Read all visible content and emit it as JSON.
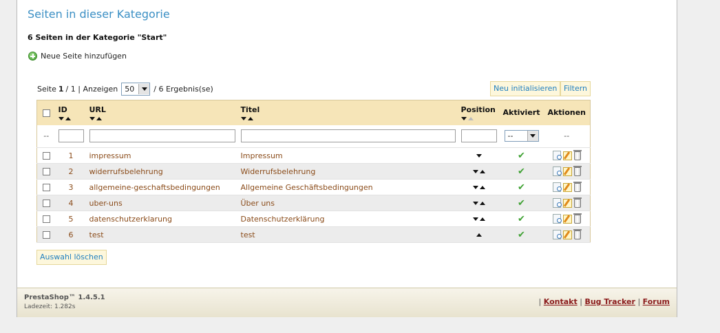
{
  "page_title": "Seiten in dieser Kategorie",
  "subtitle": "6 Seiten in der Kategorie \"Start\"",
  "add_page_label": "Neue Seite hinzufügen",
  "pagination": {
    "prefix": "Seite",
    "current": "1",
    "separator": "/ 1 | Anzeigen",
    "per_page": "50",
    "results": "/ 6 Ergebnis(se)"
  },
  "buttons": {
    "reset": "Neu initialisieren",
    "filter": "Filtern",
    "clear_selection": "Auswahl löschen"
  },
  "columns": {
    "id": "ID",
    "url": "URL",
    "title": "Titel",
    "position": "Position",
    "active": "Aktiviert",
    "actions": "Aktionen"
  },
  "filters": {
    "dash": "--",
    "active_value": "--"
  },
  "rows": [
    {
      "id": "1",
      "url": "impressum",
      "title": "Impressum",
      "pos_down": true,
      "pos_up": false
    },
    {
      "id": "2",
      "url": "widerrufsbelehrung",
      "title": "Widerrufsbelehrung",
      "pos_down": true,
      "pos_up": true
    },
    {
      "id": "3",
      "url": "allgemeine-geschaftsbedingungen",
      "title": "Allgemeine Geschäftsbedingungen",
      "pos_down": true,
      "pos_up": true
    },
    {
      "id": "4",
      "url": "uber-uns",
      "title": "Über uns",
      "pos_down": true,
      "pos_up": true
    },
    {
      "id": "5",
      "url": "datenschutzerklarung",
      "title": "Datenschutzerklärung",
      "pos_down": true,
      "pos_up": true
    },
    {
      "id": "6",
      "url": "test",
      "title": "test",
      "pos_down": false,
      "pos_up": true
    }
  ],
  "footer": {
    "brand": "PrestaShop™ 1.4.5.1",
    "load_time": "Ladezeit: 1.282s",
    "sep": "|",
    "links": [
      "Kontakt",
      "Bug Tracker",
      "Forum"
    ]
  },
  "colors": {
    "accent": "#3b8fc4",
    "header_bg": "#f6e5b8",
    "link_brown": "#8a4b19",
    "check_green": "#3ea132"
  }
}
